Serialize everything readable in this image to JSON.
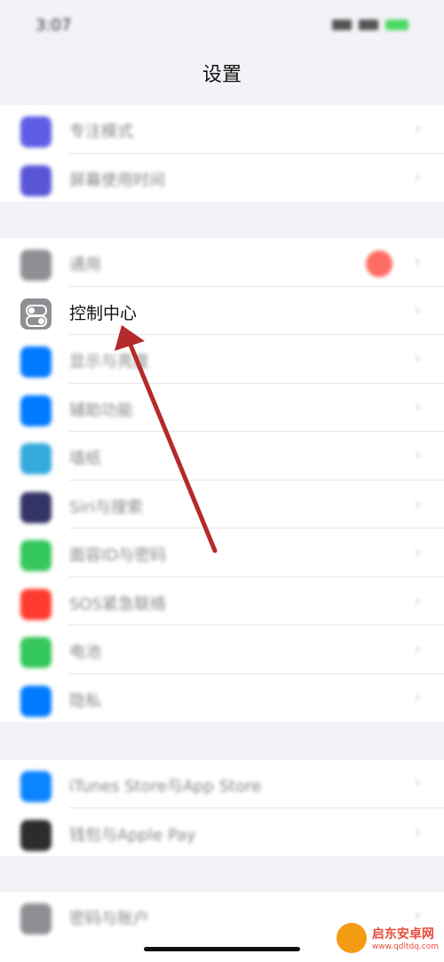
{
  "status": {
    "time": "3:07"
  },
  "title": "设置",
  "groups": [
    {
      "rows": [
        {
          "label": "专注模式",
          "icon": "moon-icon",
          "color": "#5e5ce6"
        },
        {
          "label": "屏幕使用时间",
          "icon": "hourglass-icon",
          "color": "#5856d6"
        }
      ]
    },
    {
      "rows": [
        {
          "label": "通用",
          "icon": "gear-icon",
          "color": "#8e8e93",
          "badge": true
        },
        {
          "label": "控制中心",
          "icon": "toggle-icon",
          "color": "#8e8e93",
          "focus": true
        },
        {
          "label": "显示与亮度",
          "icon": "aa-icon",
          "color": "#007aff"
        },
        {
          "label": "辅助功能",
          "icon": "accessibility-icon",
          "color": "#007aff"
        },
        {
          "label": "墙纸",
          "icon": "flower-icon",
          "color": "#34aadc"
        },
        {
          "label": "Siri与搜索",
          "icon": "siri-icon",
          "color": "#333366"
        },
        {
          "label": "面容ID与密码",
          "icon": "faceid-icon",
          "color": "#34c759"
        },
        {
          "label": "SOS紧急联络",
          "icon": "sos-icon",
          "color": "#ff3b30"
        },
        {
          "label": "电池",
          "icon": "battery-icon",
          "color": "#34c759"
        },
        {
          "label": "隐私",
          "icon": "hand-icon",
          "color": "#007aff"
        }
      ]
    },
    {
      "rows": [
        {
          "label": "iTunes Store与App Store",
          "icon": "appstore-icon",
          "color": "#0a84ff"
        },
        {
          "label": "钱包与Apple Pay",
          "icon": "wallet-icon",
          "color": "#2c2c2e"
        }
      ]
    },
    {
      "rows": [
        {
          "label": "密码与账户",
          "icon": "key-icon",
          "color": "#8e8e93"
        }
      ]
    }
  ],
  "watermark": {
    "name": "启东安卓网",
    "url": "www.qdltdq.com"
  }
}
